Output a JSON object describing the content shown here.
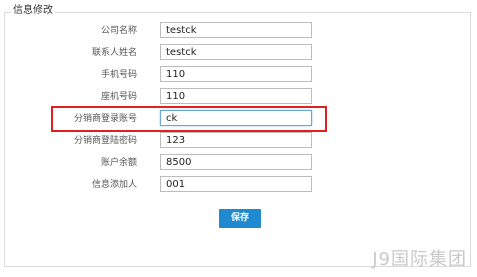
{
  "form": {
    "legend": "信息修改",
    "fields": [
      {
        "label": "公司名称",
        "value": "testck"
      },
      {
        "label": "联系人姓名",
        "value": "testck"
      },
      {
        "label": "手机号码",
        "value": "110"
      },
      {
        "label": "座机号码",
        "value": "110"
      },
      {
        "label": "分销商登录账号",
        "value": "ck"
      },
      {
        "label": "分销商登陆密码",
        "value": "123"
      },
      {
        "label": "账户余额",
        "value": "8500"
      },
      {
        "label": "信息添加人",
        "value": "001"
      }
    ],
    "save_label": "保存"
  },
  "watermark": "J9国际集团",
  "colors": {
    "highlight": "#e02020",
    "button": "#1f8ad0"
  }
}
